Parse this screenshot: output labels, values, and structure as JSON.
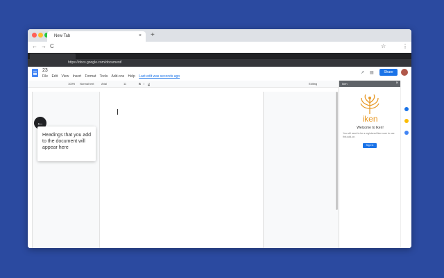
{
  "browser": {
    "tab_title": "New Tab",
    "tab_close": "×",
    "new_tab": "+",
    "url": "",
    "nav_back": "←",
    "nav_forward": "→",
    "nav_reload": "C",
    "star": "☆",
    "menu": "⋮"
  },
  "inner_browser": {
    "url": "https://docs.google.com/document/"
  },
  "docs": {
    "title": "23",
    "menu": [
      "File",
      "Edit",
      "View",
      "Insert",
      "Format",
      "Tools",
      "Add-ons",
      "Help"
    ],
    "last_edit": "Last edit was seconds ago",
    "share": "Share",
    "toolbar": {
      "zoom": "100%",
      "style": "Normal text",
      "font": "Arial",
      "size": "11",
      "mode": "Editing"
    }
  },
  "outline": {
    "back_icon": "arrow-left-icon",
    "message": "Headings that you add to the document will appear here"
  },
  "panel": {
    "name": "Iken",
    "close": "×",
    "brand": "iken",
    "welcome": "Welcome to Iken!",
    "description": "You will need to be a registered Iken user to use this add-on.",
    "signin": "Sign in"
  },
  "colors": {
    "background": "#2b4aa0",
    "accent": "#1a73e8",
    "brand": "#e89b2b"
  }
}
